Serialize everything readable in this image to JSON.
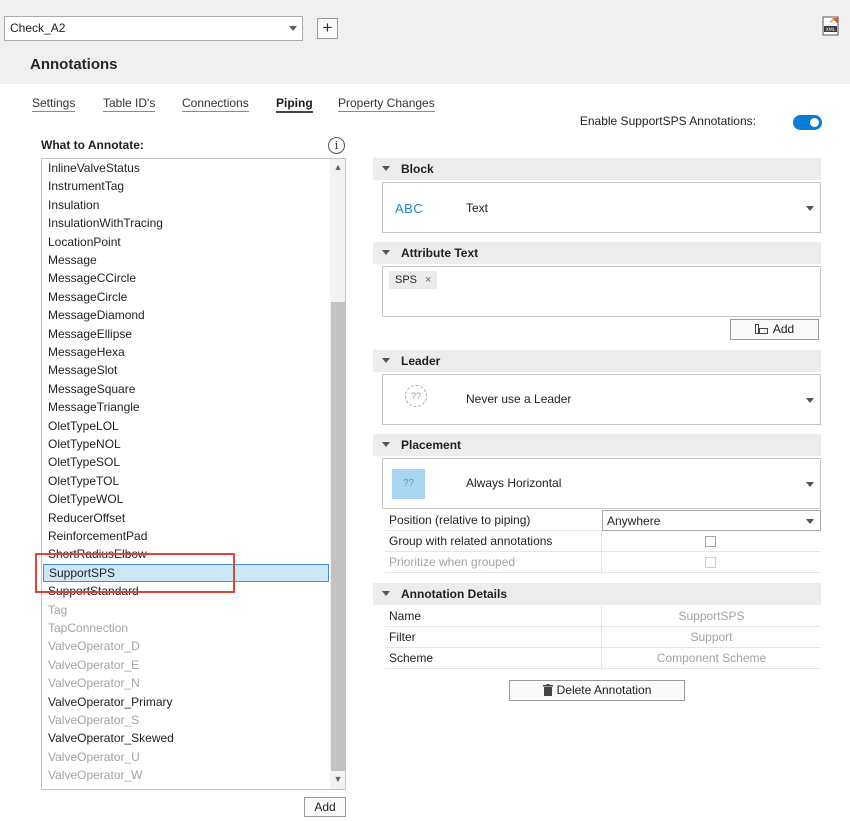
{
  "header": {
    "profile": "Check_A2",
    "add_icon": "+",
    "title": "Annotations",
    "export_icon": "xml-export-icon"
  },
  "tabs": [
    {
      "label": "Settings",
      "active": false
    },
    {
      "label": "Table ID's",
      "active": false
    },
    {
      "label": "Connections",
      "active": false
    },
    {
      "label": "Piping",
      "active": true
    },
    {
      "label": "Property Changes",
      "active": false
    }
  ],
  "enable_toggle": {
    "label": "Enable SupportSPS Annotations:",
    "on": true,
    "color": "#0a7bd8"
  },
  "what_to_annotate": {
    "label": "What to Annotate:",
    "info_icon": "i",
    "scroll_up": "▲",
    "scroll_down": "▼",
    "items": [
      {
        "label": "InlineValveStatus",
        "disabled": false
      },
      {
        "label": "InstrumentTag",
        "disabled": false
      },
      {
        "label": "Insulation",
        "disabled": false
      },
      {
        "label": "InsulationWithTracing",
        "disabled": false
      },
      {
        "label": "LocationPoint",
        "disabled": false
      },
      {
        "label": "Message",
        "disabled": false
      },
      {
        "label": "MessageCCircle",
        "disabled": false
      },
      {
        "label": "MessageCircle",
        "disabled": false
      },
      {
        "label": "MessageDiamond",
        "disabled": false
      },
      {
        "label": "MessageEllipse",
        "disabled": false
      },
      {
        "label": "MessageHexa",
        "disabled": false
      },
      {
        "label": "MessageSlot",
        "disabled": false
      },
      {
        "label": "MessageSquare",
        "disabled": false
      },
      {
        "label": "MessageTriangle",
        "disabled": false
      },
      {
        "label": "OletTypeLOL",
        "disabled": false
      },
      {
        "label": "OletTypeNOL",
        "disabled": false
      },
      {
        "label": "OletTypeSOL",
        "disabled": false
      },
      {
        "label": "OletTypeTOL",
        "disabled": false
      },
      {
        "label": "OletTypeWOL",
        "disabled": false
      },
      {
        "label": "ReducerOffset",
        "disabled": false
      },
      {
        "label": "ReinforcementPad",
        "disabled": false
      },
      {
        "label": "ShortRadiusElbow",
        "disabled": false
      },
      {
        "label": "SupportSPS",
        "disabled": false,
        "selected": true
      },
      {
        "label": "SupportStandard",
        "disabled": false
      },
      {
        "label": "Tag",
        "disabled": true
      },
      {
        "label": "TapConnection",
        "disabled": true
      },
      {
        "label": "ValveOperator_D",
        "disabled": true
      },
      {
        "label": "ValveOperator_E",
        "disabled": true
      },
      {
        "label": "ValveOperator_N",
        "disabled": true
      },
      {
        "label": "ValveOperator_Primary",
        "disabled": false
      },
      {
        "label": "ValveOperator_S",
        "disabled": true
      },
      {
        "label": "ValveOperator_Skewed",
        "disabled": false
      },
      {
        "label": "ValveOperator_U",
        "disabled": true
      },
      {
        "label": "ValveOperator_W",
        "disabled": true
      }
    ],
    "add_label": "Add"
  },
  "block": {
    "title": "Block",
    "icon_text": "ABC",
    "value": "Text"
  },
  "attribute_text": {
    "title": "Attribute Text",
    "chip": "SPS",
    "chip_remove": "×",
    "add_label": "Add"
  },
  "leader": {
    "title": "Leader",
    "icon_text": "??",
    "value": "Never use a Leader"
  },
  "placement": {
    "title": "Placement",
    "icon_text": "??",
    "value": "Always Horizontal",
    "position_label": "Position (relative to piping)",
    "position_value": "Anywhere",
    "group_label": "Group with related annotations",
    "group_checked": false,
    "prioritize_label": "Prioritize when grouped",
    "prioritize_checked": false
  },
  "annotation_details": {
    "title": "Annotation Details",
    "rows": [
      {
        "label": "Name",
        "value": "SupportSPS"
      },
      {
        "label": "Filter",
        "value": "Support"
      },
      {
        "label": "Scheme",
        "value": "Component Scheme"
      }
    ]
  },
  "delete_label": "Delete Annotation"
}
